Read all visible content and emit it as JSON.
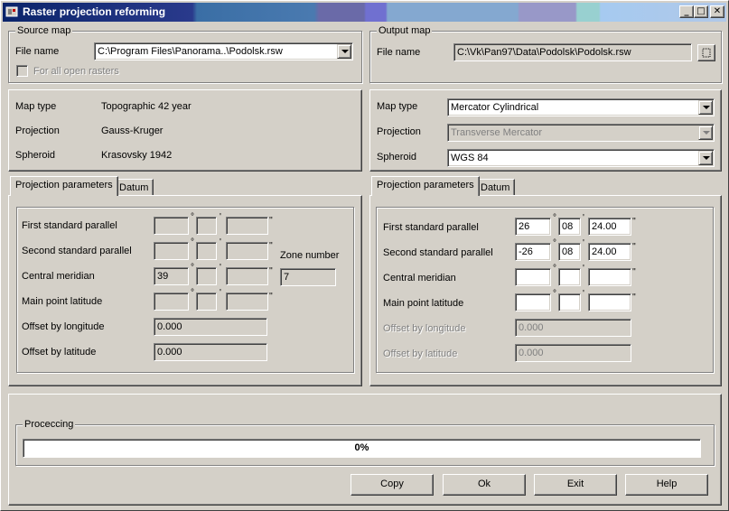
{
  "window": {
    "title": "Raster projection reforming",
    "minimize": "_",
    "maximize": "□",
    "close": "✕"
  },
  "source": {
    "group_label": "Source map",
    "file_label": "File name",
    "file_value": "C:\\Program Files\\Panorama..\\Podolsk.rsw",
    "all_rasters_label": "For all open rasters",
    "map_type_label": "Map type",
    "map_type_value": "Topographic 42 year",
    "projection_label": "Projection",
    "projection_value": "Gauss-Kruger",
    "spheroid_label": "Spheroid",
    "spheroid_value": "Krasovsky 1942",
    "tabs": [
      "Projection parameters",
      "Datum"
    ],
    "params": {
      "first_label": "First standard parallel",
      "second_label": "Second standard parallel",
      "central_label": "Central meridian",
      "main_label": "Main point latitude",
      "offset_lon_label": "Offset by longitude",
      "offset_lat_label": "Offset by latitude",
      "zone_label": "Zone number",
      "central_deg": "39",
      "zone_value": "7",
      "offset_lon": "0.000",
      "offset_lat": "0.000"
    }
  },
  "output": {
    "group_label": "Output map",
    "file_label": "File name",
    "file_value": "C:\\Vk\\Pan97\\Data\\Podolsk\\Podolsk.rsw",
    "map_type_label": "Map type",
    "map_type_value": "Mercator Cylindrical",
    "projection_label": "Projection",
    "projection_value": "Transverse Mercator",
    "spheroid_label": "Spheroid",
    "spheroid_value": "WGS 84",
    "tabs": [
      "Projection parameters",
      "Datum"
    ],
    "params": {
      "first_label": "First standard parallel",
      "second_label": "Second standard parallel",
      "central_label": "Central meridian",
      "main_label": "Main point latitude",
      "offset_lon_label": "Offset by longitude",
      "offset_lat_label": "Offset by latitude",
      "first_deg": "26",
      "first_min": "08",
      "first_sec": "24.00",
      "second_deg": "-26",
      "second_min": "08",
      "second_sec": "24.00",
      "offset_lon": "0.000",
      "offset_lat": "0.000"
    }
  },
  "symbols": {
    "deg": "°",
    "min": "'",
    "sec": "''"
  },
  "processing": {
    "group_label": "Proceccing",
    "progress_fraction": 0,
    "progress_text": "0%"
  },
  "buttons": {
    "copy": "Copy",
    "ok": "Ok",
    "exit": "Exit",
    "help": "Help"
  },
  "colors": {
    "title_start": "#0a246a",
    "face": "#d4d0c8"
  }
}
